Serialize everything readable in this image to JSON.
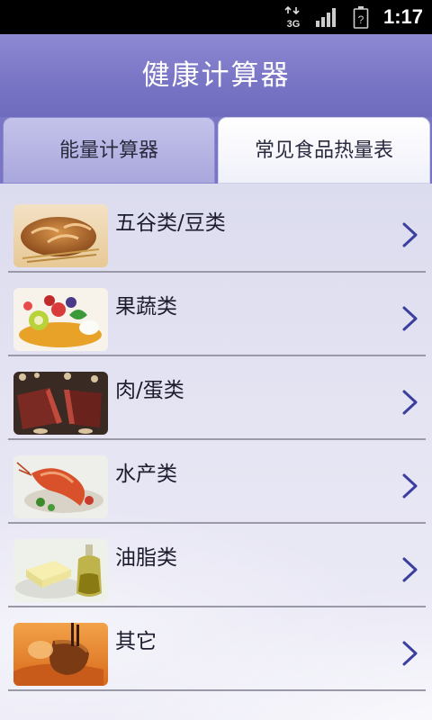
{
  "status_bar": {
    "network": "3G",
    "battery_icon": "battery-unknown-icon",
    "signal_icon": "signal-bars-icon",
    "time": "1:17"
  },
  "title_bar": {
    "title": "健康计算器"
  },
  "tabs": [
    {
      "label": "能量计算器",
      "selected": false
    },
    {
      "label": "常见食品热量表",
      "selected": true
    }
  ],
  "food_categories": [
    {
      "label": "五谷类/豆类",
      "image": "bread-image",
      "icon": "chevron-right-icon"
    },
    {
      "label": "果蔬类",
      "image": "fruit-salad-image",
      "icon": "chevron-right-icon"
    },
    {
      "label": "肉/蛋类",
      "image": "steak-image",
      "icon": "chevron-right-icon"
    },
    {
      "label": "水产类",
      "image": "shrimp-image",
      "icon": "chevron-right-icon"
    },
    {
      "label": "油脂类",
      "image": "butter-oil-image",
      "icon": "chevron-right-icon"
    },
    {
      "label": "其它",
      "image": "dessert-image",
      "icon": "chevron-right-icon"
    }
  ],
  "colors": {
    "title_bar": "#7a76c6",
    "chevron": "#3a3fa0",
    "list_background": "#e6e5f3"
  }
}
